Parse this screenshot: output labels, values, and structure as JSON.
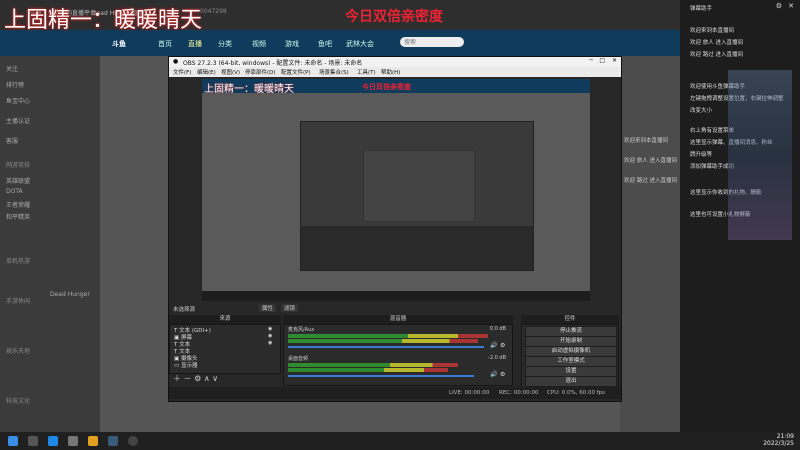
{
  "overlay": {
    "left_title": "上固精一：暖暖晴天",
    "center_title": "今日双倍亲密度"
  },
  "browser": {
    "tabs": [
      "斗鱼 - 每个人的直播平台",
      "Dead Hunger直播..."
    ],
    "url_fragment": "0047298"
  },
  "site_nav": {
    "logo": "斗鱼",
    "items": [
      "首页",
      "直播",
      "分类",
      "视频",
      "游戏",
      "鱼吧",
      "武林大会"
    ],
    "search_placeholder": "搜索"
  },
  "left_nav": {
    "items": [
      "关注",
      "排行榜",
      "鱼宝中心",
      "主播认证",
      "客服",
      "网游竞技",
      "单机热游",
      "手游休闲",
      "娱乐天地",
      "科技文化"
    ],
    "sub_items": [
      "英雄联盟",
      "DOTA",
      "王者荣耀",
      "和平精英",
      "Dead Hunger"
    ]
  },
  "obs": {
    "title": "OBS 27.2.3 (64-bit, windows) - 配置文件: 未命名 - 场景: 未命名",
    "menu": [
      "文件(F)",
      "编辑(E)",
      "视图(V)",
      "停靠部件(D)",
      "配置文件(P)",
      "场景集合(S)",
      "工具(T)",
      "帮助(H)"
    ],
    "scene_label": "未选择源",
    "props_label": "属性",
    "filters_label": "滤镜",
    "panels": {
      "sources": "来源",
      "mixer": "混音器",
      "controls": "控件"
    },
    "sources": [
      {
        "icon": "T",
        "name": "文本 (GDI+)"
      },
      {
        "icon": "▣",
        "name": "屏幕"
      },
      {
        "icon": "T",
        "name": "文本"
      },
      {
        "icon": "T",
        "name": "文本"
      },
      {
        "icon": "▣",
        "name": "摄像头"
      },
      {
        "icon": "▭",
        "name": "显示器"
      }
    ],
    "mixer": [
      {
        "name": "麦克风/Aux",
        "db": "0.0 dB"
      },
      {
        "name": "桌面音频",
        "db": "-2.0 dB"
      }
    ],
    "controls": [
      "停止推流",
      "开始录制",
      "启动虚拟摄像机",
      "工作室模式",
      "设置",
      "退出"
    ],
    "status": {
      "live": "LIVE: 00:00:00",
      "rec": "REC: 00:00:00",
      "cpu": "CPU: 0.0%, 60.00 fps"
    }
  },
  "chat_panel": {
    "header": "弹幕助手",
    "lines": [
      "欢迎来到本直播间",
      "欢迎 旅人 进入直播间",
      "欢迎 路过 进入直播间",
      "欢迎使用斗鱼弹幕助手",
      "左键拖拽调整设置位置，右键拉伸调整",
      "改变大小",
      "右上角有设置菜单",
      "这里显示弹幕、直播间消息、粉丝",
      "牌升级等",
      "添加弹幕助手成功",
      "这里显示你收到的礼物、酬勤",
      "这里也可设置小礼物屏蔽"
    ]
  },
  "taskbar": {
    "time": "21:09",
    "date": "2022/3/25"
  }
}
